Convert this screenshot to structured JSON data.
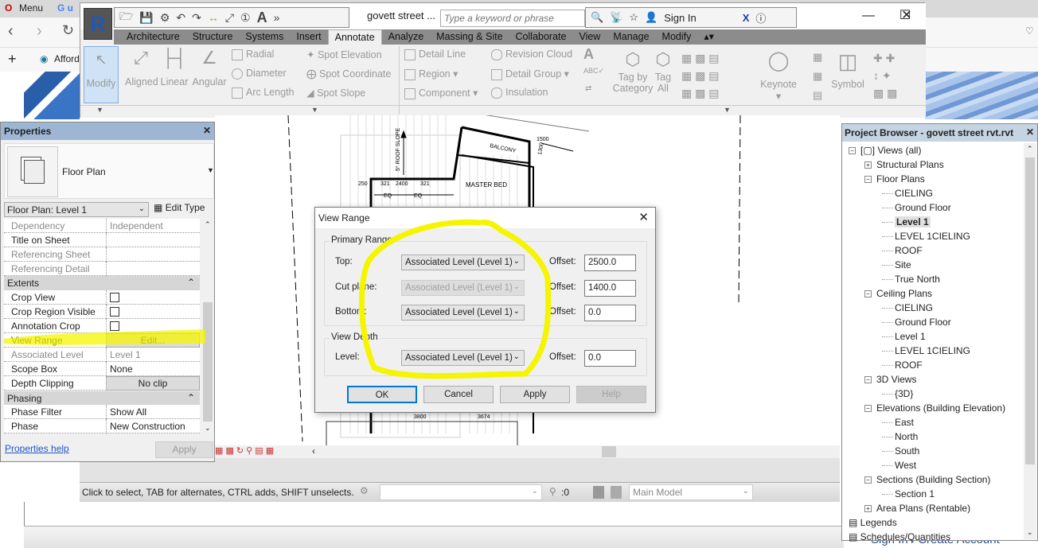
{
  "browser": {
    "tab1": "Menu",
    "tab2": "G u",
    "bookmark": "Afford",
    "account_link": "Sign In / Create Account"
  },
  "revit": {
    "document_title": "govett street ...",
    "search_placeholder": "Type a keyword or phrase",
    "sign_in": "Sign In",
    "tabs": [
      "Architecture",
      "Structure",
      "Systems",
      "Insert",
      "Annotate",
      "Analyze",
      "Massing & Site",
      "Collaborate",
      "View",
      "Manage",
      "Modify"
    ],
    "active_tab": "Annotate",
    "ribbon": {
      "modify": "Modify",
      "aligned": "Aligned",
      "linear": "Linear",
      "angular": "Angular",
      "radial": "Radial",
      "diameter": "Diameter",
      "arc_length": "Arc Length",
      "spot_elevation": "Spot Elevation",
      "spot_coordinate": "Spot Coordinate",
      "spot_slope": "Spot Slope",
      "detail_line": "Detail Line",
      "region": "Region",
      "component": "Component",
      "revision_cloud": "Revision Cloud",
      "detail_group": "Detail Group",
      "insulation": "Insulation",
      "tag_by_category_1": "Tag by",
      "tag_by_category_2": "Category",
      "tag_all_1": "Tag",
      "tag_all_2": "All",
      "keynote": "Keynote",
      "symbol": "Symbol"
    }
  },
  "properties": {
    "title": "Properties",
    "type_name": "Floor Plan",
    "instance_selector": "Floor Plan: Level 1",
    "edit_type": "Edit Type",
    "rows": [
      {
        "key": "Dependency",
        "value": "Independent",
        "disabled": true
      },
      {
        "key": "Title on Sheet",
        "value": ""
      },
      {
        "key": "Referencing Sheet",
        "value": "",
        "disabled": true
      },
      {
        "key": "Referencing Detail",
        "value": "",
        "disabled": true
      }
    ],
    "sections": {
      "extents": "Extents",
      "phasing": "Phasing"
    },
    "extents_rows": [
      {
        "key": "Crop View",
        "checked": false
      },
      {
        "key": "Crop Region Visible",
        "checked": false
      },
      {
        "key": "Annotation Crop",
        "checked": false
      },
      {
        "key": "View Range",
        "value": "Edit..."
      },
      {
        "key": "Associated Level",
        "value": "Level 1",
        "disabled": true
      },
      {
        "key": "Scope Box",
        "value": "None"
      },
      {
        "key": "Depth Clipping",
        "value": "No clip"
      }
    ],
    "phasing_rows": [
      {
        "key": "Phase Filter",
        "value": "Show All"
      },
      {
        "key": "Phase",
        "value": "New Construction"
      }
    ],
    "help_link": "Properties help",
    "apply": "Apply"
  },
  "canvas": {
    "labels": {
      "master_bed": "MASTER BED",
      "balcony": "BALCONY",
      "roof_slope": "5° ROOF SLOPE",
      "d250": "250",
      "d321a": "321",
      "d2400": "2400",
      "d321b": "321",
      "eq1": "EQ",
      "eq2": "EQ",
      "d1500": "1500",
      "d1300": "1300",
      "d3800": "3800",
      "d3674": "3674"
    }
  },
  "dialog": {
    "title": "View Range",
    "primary_range": "Primary Range",
    "view_depth": "View Depth",
    "top_label": "Top:",
    "cut_label": "Cut plane:",
    "bottom_label": "Bottom:",
    "level_label": "Level:",
    "offset_label": "Offset:",
    "top_level": "Associated Level (Level 1)",
    "top_offset": "2500.0",
    "cut_level": "Associated Level (Level 1)",
    "cut_offset": "1400.0",
    "bottom_level": "Associated Level (Level 1)",
    "bottom_offset": "0.0",
    "depth_level": "Associated Level (Level 1)",
    "depth_offset": "0.0",
    "ok": "OK",
    "cancel": "Cancel",
    "apply": "Apply",
    "help": "Help"
  },
  "status": {
    "hint": "Click to select, TAB for alternates, CTRL adds, SHIFT unselects.",
    "filter_count": ":0",
    "model": "Main Model"
  },
  "project_browser": {
    "title": "Project Browser - govett street rvt.rvt",
    "nodes": [
      {
        "label": "Views (all)",
        "level": 0,
        "toggle": "−"
      },
      {
        "label": "Structural Plans",
        "level": 1,
        "toggle": "+"
      },
      {
        "label": "Floor Plans",
        "level": 1,
        "toggle": "−"
      },
      {
        "label": "CIELING",
        "level": 2
      },
      {
        "label": "Ground Floor",
        "level": 2
      },
      {
        "label": "Level 1",
        "level": 2,
        "selected": true
      },
      {
        "label": "LEVEL 1CIELING",
        "level": 2
      },
      {
        "label": "ROOF",
        "level": 2
      },
      {
        "label": "Site",
        "level": 2
      },
      {
        "label": "True North",
        "level": 2
      },
      {
        "label": "Ceiling Plans",
        "level": 1,
        "toggle": "−"
      },
      {
        "label": "CIELING",
        "level": 2
      },
      {
        "label": "Ground Floor",
        "level": 2
      },
      {
        "label": "Level 1",
        "level": 2
      },
      {
        "label": "LEVEL 1CIELING",
        "level": 2
      },
      {
        "label": "ROOF",
        "level": 2
      },
      {
        "label": "3D Views",
        "level": 1,
        "toggle": "−"
      },
      {
        "label": "{3D}",
        "level": 2
      },
      {
        "label": "Elevations (Building Elevation)",
        "level": 1,
        "toggle": "−"
      },
      {
        "label": "East",
        "level": 2
      },
      {
        "label": "North",
        "level": 2
      },
      {
        "label": "South",
        "level": 2
      },
      {
        "label": "West",
        "level": 2
      },
      {
        "label": "Sections (Building Section)",
        "level": 1,
        "toggle": "−"
      },
      {
        "label": "Section 1",
        "level": 2
      },
      {
        "label": "Area Plans (Rentable)",
        "level": 1,
        "toggle": "+"
      },
      {
        "label": "Legends",
        "level": 0
      },
      {
        "label": "Schedules/Quantities",
        "level": 0
      }
    ]
  },
  "colors": {
    "highlight": "#f5f500",
    "props_title": "#9db6d3",
    "browser_title": "#c6d3e2",
    "ok_border": "#0078d7"
  }
}
